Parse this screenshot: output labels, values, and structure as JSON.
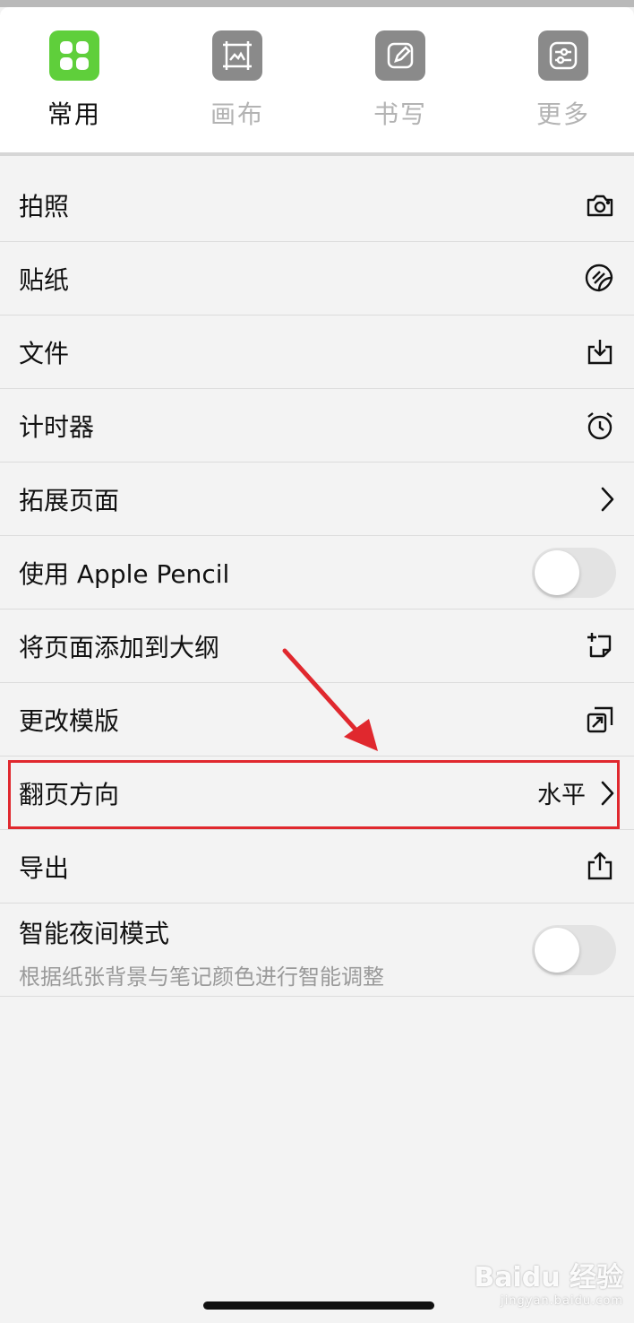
{
  "tabs": [
    {
      "label": "常用",
      "icon": "grid-icon",
      "active": true
    },
    {
      "label": "画布",
      "icon": "canvas-icon",
      "active": false
    },
    {
      "label": "书写",
      "icon": "pencil-icon",
      "active": false
    },
    {
      "label": "更多",
      "icon": "sliders-icon",
      "active": false
    }
  ],
  "menu": {
    "camera": {
      "label": "拍照",
      "icon": "camera-icon"
    },
    "sticker": {
      "label": "贴纸",
      "icon": "sticker-icon"
    },
    "file": {
      "label": "文件",
      "icon": "download-tray-icon"
    },
    "timer": {
      "label": "计时器",
      "icon": "alarm-clock-icon"
    },
    "extend_page": {
      "label": "拓展页面",
      "icon": "chevron-right-icon"
    },
    "apple_pencil": {
      "label": "使用 Apple Pencil",
      "toggle_on": false
    },
    "add_outline": {
      "label": "将页面添加到大纲",
      "icon": "add-page-icon"
    },
    "change_template": {
      "label": "更改模版",
      "icon": "swap-template-icon"
    },
    "page_direction": {
      "label": "翻页方向",
      "value": "水平",
      "icon": "chevron-right-icon"
    },
    "export": {
      "label": "导出",
      "icon": "share-icon"
    },
    "night_mode": {
      "label": "智能夜间模式",
      "sublabel": "根据纸张背景与笔记颜色进行智能调整",
      "toggle_on": false
    }
  },
  "watermark": {
    "brand": "Baidu 经验",
    "url": "jingyan.baidu.com"
  },
  "colors": {
    "accent_green": "#5fcf3b",
    "highlight_red": "#e0282e",
    "inactive_tab": "#8a8a8a"
  }
}
